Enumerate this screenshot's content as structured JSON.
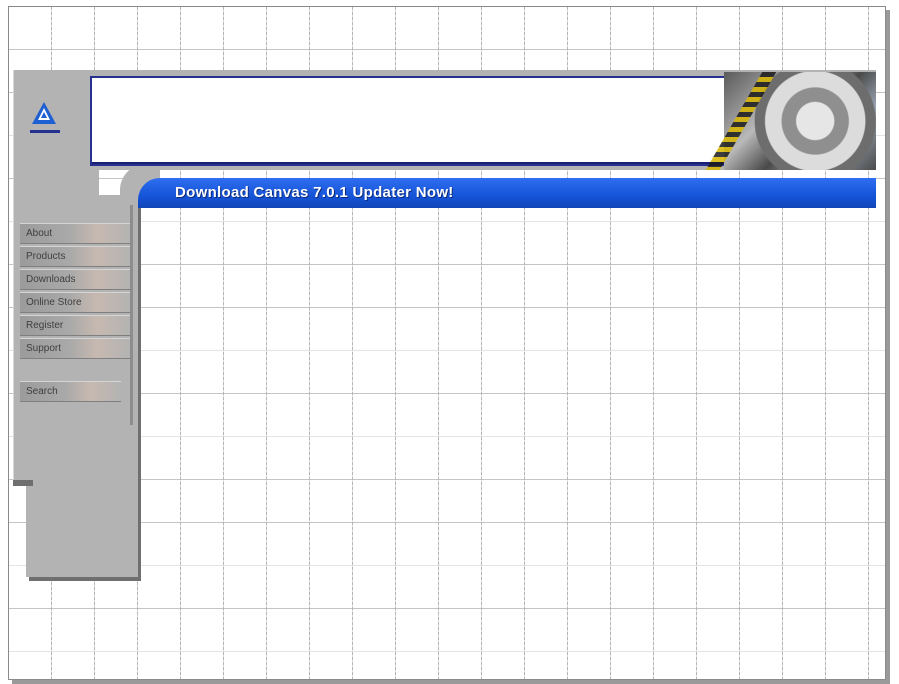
{
  "header": {
    "title": "Download Canvas 7.0.1 Updater Now!",
    "logo_icon": "triangle-logo-icon"
  },
  "sidebar": {
    "items": [
      {
        "label": "About"
      },
      {
        "label": "Products"
      },
      {
        "label": "Downloads"
      },
      {
        "label": "Online Store"
      },
      {
        "label": "Register"
      },
      {
        "label": "Support"
      }
    ],
    "search_label": "Search"
  },
  "colors": {
    "title_bar": "#1554d8",
    "frame_gray": "#b3b3b3",
    "banner_border": "#26308e"
  }
}
